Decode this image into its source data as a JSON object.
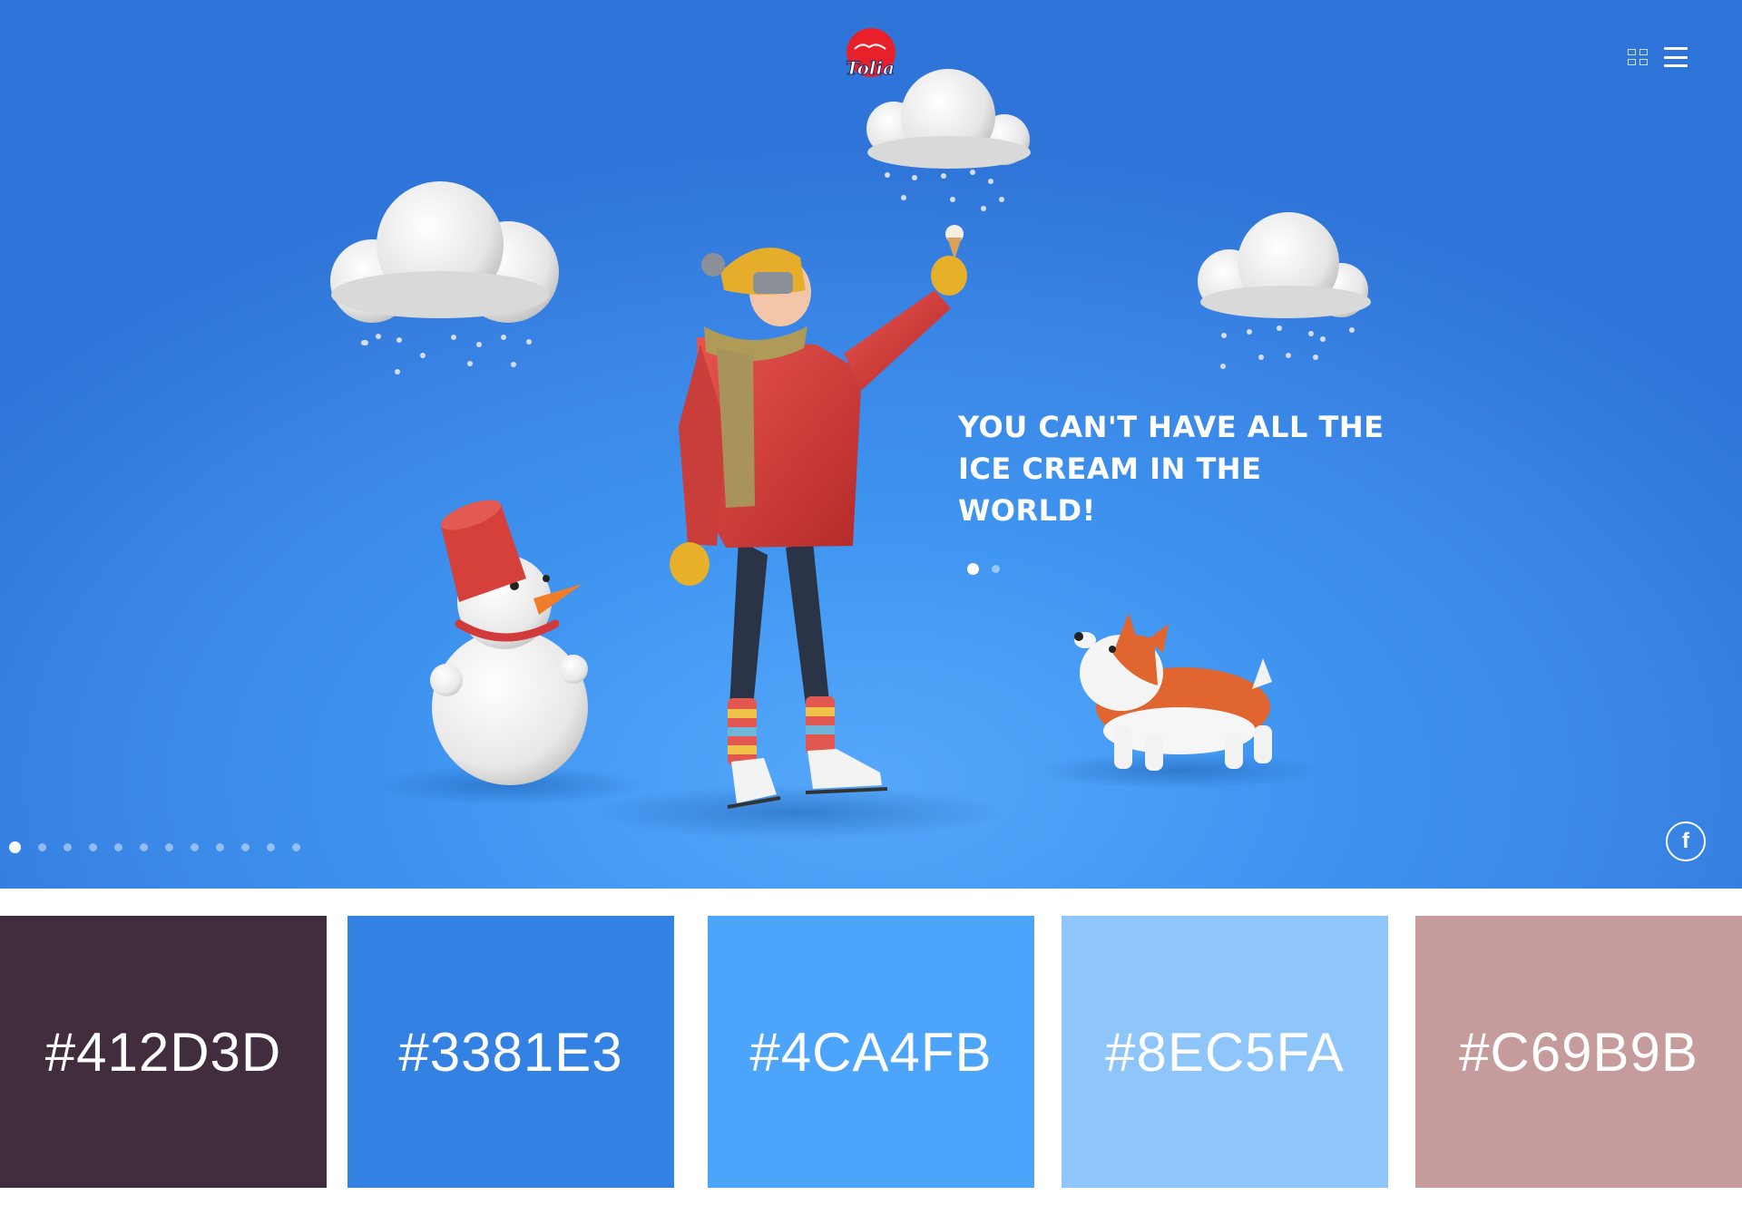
{
  "brand": {
    "logo_text": "Tolia",
    "logo_color": "#e8202a"
  },
  "header": {
    "grid_icon": "grid-icon",
    "menu_icon": "hamburger-icon"
  },
  "hero": {
    "headline_line1": "YOU CAN'T HAVE ALL THE",
    "headline_line2": "ICE CREAM IN THE",
    "headline_line3": "WORLD!",
    "slide_dots": {
      "count": 2,
      "active": 1
    },
    "page_dots": {
      "count": 12,
      "active": 1
    },
    "background_color": "#3a86e6"
  },
  "social": {
    "facebook_label": "f"
  },
  "palette": {
    "swatches": [
      {
        "hex": "#412D3D",
        "color": "#412D3D"
      },
      {
        "hex": "#3381E3",
        "color": "#3381E3"
      },
      {
        "hex": "#4CA4FB",
        "color": "#4CA4FB"
      },
      {
        "hex": "#8EC5FA",
        "color": "#8EC5FA"
      },
      {
        "hex": "#C69B9B",
        "color": "#C69B9B"
      }
    ]
  }
}
